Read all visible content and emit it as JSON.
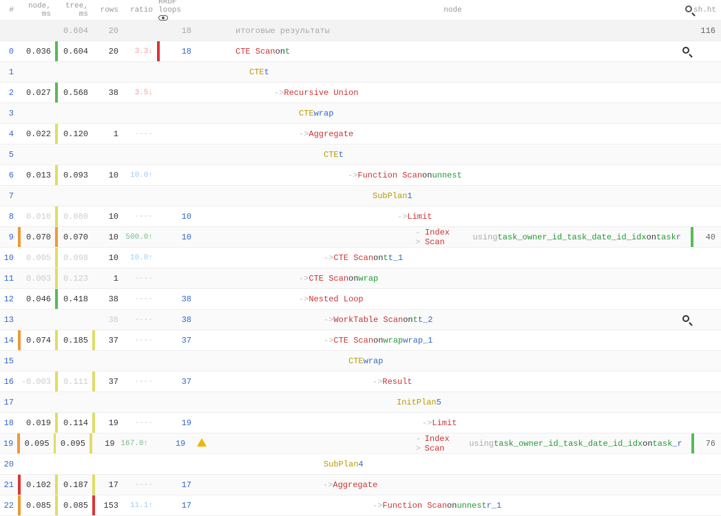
{
  "headers": {
    "idx": "#",
    "node": "node, ms",
    "tree": "tree, ms",
    "rows": "rows",
    "ratio": "ratio",
    "loops": "RRbF loops",
    "main": "node",
    "sh": "sh.ht"
  },
  "summary": {
    "tree": "0.604",
    "rows": "20",
    "loops": "18",
    "label": "итоговые результаты",
    "sh": "116"
  },
  "rows": [
    {
      "i": "0",
      "alt": false,
      "b1": "",
      "node": "0.036",
      "b2": "bar-g",
      "tree": "0.604",
      "b3": "",
      "rows": "20",
      "ratio": "3.3↓",
      "ratioCls": "ratio-down",
      "b4": "bar-r",
      "loops": "18",
      "warn": false,
      "indent": 16,
      "frags": [
        {
          "t": "CTE Scan",
          "c": "op"
        },
        {
          "t": " on ",
          "c": ""
        },
        {
          "t": "t",
          "c": "alias"
        }
      ],
      "mag": true,
      "sh": ""
    },
    {
      "i": "1",
      "alt": true,
      "b1": "",
      "node": "",
      "b2": "",
      "tree": "",
      "b3": "",
      "rows": "",
      "ratio": "",
      "ratioCls": "",
      "b4": "",
      "loops": "",
      "warn": false,
      "indent": 36,
      "frags": [
        {
          "t": "CTE ",
          "c": "kw"
        },
        {
          "t": "t",
          "c": "cte"
        }
      ],
      "mag": false,
      "sh": ""
    },
    {
      "i": "2",
      "alt": false,
      "b1": "",
      "node": "0.027",
      "b2": "bar-g",
      "tree": "0.568",
      "b3": "",
      "rows": "38",
      "ratio": "3.5↓",
      "ratioCls": "ratio-down",
      "b4": "",
      "loops": "",
      "warn": false,
      "indent": 72,
      "frags": [
        {
          "t": "->  ",
          "c": "dim"
        },
        {
          "t": "Recursive Union",
          "c": "op"
        }
      ],
      "mag": false,
      "sh": ""
    },
    {
      "i": "3",
      "alt": true,
      "b1": "",
      "node": "",
      "b2": "",
      "tree": "",
      "b3": "",
      "rows": "",
      "ratio": "",
      "ratioCls": "",
      "b4": "",
      "loops": "",
      "warn": false,
      "indent": 108,
      "frags": [
        {
          "t": "CTE ",
          "c": "kw"
        },
        {
          "t": "wrap",
          "c": "cte"
        }
      ],
      "mag": false,
      "sh": ""
    },
    {
      "i": "4",
      "alt": false,
      "b1": "",
      "node": "0.022",
      "b2": "bar-y",
      "tree": "0.120",
      "b3": "",
      "rows": "1",
      "ratio": "----",
      "ratioCls": "faded",
      "b4": "",
      "loops": "",
      "warn": false,
      "indent": 108,
      "frags": [
        {
          "t": "->  ",
          "c": "dim"
        },
        {
          "t": "Aggregate",
          "c": "op"
        }
      ],
      "mag": false,
      "sh": ""
    },
    {
      "i": "5",
      "alt": true,
      "b1": "",
      "node": "",
      "b2": "",
      "tree": "",
      "b3": "",
      "rows": "",
      "ratio": "",
      "ratioCls": "",
      "b4": "",
      "loops": "",
      "warn": false,
      "indent": 144,
      "frags": [
        {
          "t": "CTE ",
          "c": "kw"
        },
        {
          "t": "t",
          "c": "cte"
        }
      ],
      "mag": false,
      "sh": ""
    },
    {
      "i": "6",
      "alt": false,
      "b1": "",
      "node": "0.013",
      "b2": "bar-y",
      "tree": "0.093",
      "b3": "",
      "rows": "10",
      "ratio": "10.0↑",
      "ratioCls": "ratio-up",
      "b4": "",
      "loops": "",
      "warn": false,
      "indent": 179,
      "frags": [
        {
          "t": "->  ",
          "c": "dim"
        },
        {
          "t": "Function Scan",
          "c": "op"
        },
        {
          "t": " on ",
          "c": ""
        },
        {
          "t": "unnest",
          "c": "alias"
        }
      ],
      "mag": false,
      "sh": ""
    },
    {
      "i": "7",
      "alt": true,
      "b1": "",
      "node": "",
      "b2": "",
      "tree": "",
      "b3": "",
      "rows": "",
      "ratio": "",
      "ratioCls": "",
      "b4": "",
      "loops": "",
      "warn": false,
      "indent": 215,
      "frags": [
        {
          "t": "SubPlan ",
          "c": "kw"
        },
        {
          "t": "1",
          "c": "num"
        }
      ],
      "mag": false,
      "sh": ""
    },
    {
      "i": "8",
      "alt": false,
      "b1": "",
      "nodeCls": "faded",
      "node": "0.010",
      "b2": "bar-y",
      "treeCls": "faded",
      "tree": "0.080",
      "b3": "",
      "rows": "10",
      "ratio": "----",
      "ratioCls": "faded",
      "b4": "",
      "loops": "10",
      "warn": false,
      "indent": 251,
      "frags": [
        {
          "t": "->  ",
          "c": "dim"
        },
        {
          "t": "Limit",
          "c": "op"
        }
      ],
      "mag": false,
      "sh": ""
    },
    {
      "i": "9",
      "alt": true,
      "b1": "bar-o",
      "node": "0.070",
      "b2": "bar-o",
      "tree": "0.070",
      "b3": "",
      "rows": "10",
      "ratio": "500.0↑",
      "ratioCls": "ratio-up2",
      "b4": "",
      "loops": "10",
      "warn": false,
      "indent": 287,
      "frags": [
        {
          "t": "->  ",
          "c": "dim"
        },
        {
          "t": "Index Scan",
          "c": "op"
        },
        {
          "t": " using ",
          "c": "dimtxt"
        },
        {
          "t": "task_owner_id_task_date_id_idx",
          "c": "alias"
        },
        {
          "t": " on ",
          "c": ""
        },
        {
          "t": "task",
          "c": "alias"
        },
        {
          "t": " r",
          "c": "cte"
        }
      ],
      "mag": false,
      "shBar": "bar-g",
      "sh": "40"
    },
    {
      "i": "10",
      "alt": false,
      "b1": "",
      "nodeCls": "faded",
      "node": "0.005",
      "b2": "bar-y",
      "treeCls": "faded",
      "tree": "0.098",
      "b3": "",
      "rows": "10",
      "ratio": "10.0↑",
      "ratioCls": "ratio-up",
      "b4": "",
      "loops": "",
      "warn": false,
      "indent": 144,
      "frags": [
        {
          "t": "->  ",
          "c": "dim"
        },
        {
          "t": "CTE Scan",
          "c": "op"
        },
        {
          "t": " on ",
          "c": ""
        },
        {
          "t": "t",
          "c": "alias"
        },
        {
          "t": " t_1",
          "c": "cte"
        }
      ],
      "mag": false,
      "sh": ""
    },
    {
      "i": "11",
      "alt": true,
      "b1": "",
      "nodeCls": "faded",
      "node": "0.003",
      "b2": "bar-y",
      "treeCls": "faded",
      "tree": "0.123",
      "b3": "",
      "rows": "1",
      "ratio": "----",
      "ratioCls": "faded",
      "b4": "",
      "loops": "",
      "warn": false,
      "indent": 108,
      "frags": [
        {
          "t": "->  ",
          "c": "dim"
        },
        {
          "t": "CTE Scan",
          "c": "op"
        },
        {
          "t": " on ",
          "c": ""
        },
        {
          "t": "wrap",
          "c": "alias"
        }
      ],
      "mag": false,
      "sh": ""
    },
    {
      "i": "12",
      "alt": false,
      "b1": "",
      "node": "0.046",
      "b2": "bar-g",
      "tree": "0.418",
      "b3": "",
      "rows": "38",
      "ratio": "----",
      "ratioCls": "faded",
      "b4": "",
      "loops": "38",
      "warn": false,
      "indent": 108,
      "frags": [
        {
          "t": "->  ",
          "c": "dim"
        },
        {
          "t": "Nested Loop",
          "c": "op"
        }
      ],
      "mag": false,
      "sh": ""
    },
    {
      "i": "13",
      "alt": true,
      "b1": "",
      "node": "",
      "b2": "",
      "tree": "",
      "b3": "",
      "rowsCls": "faded",
      "rows": "38",
      "ratio": "----",
      "ratioCls": "faded",
      "b4": "",
      "loops": "38",
      "warn": false,
      "indent": 144,
      "frags": [
        {
          "t": "->  ",
          "c": "dim"
        },
        {
          "t": "WorkTable Scan",
          "c": "op"
        },
        {
          "t": " on ",
          "c": ""
        },
        {
          "t": "t",
          "c": "alias"
        },
        {
          "t": " t_2",
          "c": "cte"
        }
      ],
      "mag": true,
      "sh": ""
    },
    {
      "i": "14",
      "alt": false,
      "b1": "bar-o",
      "node": "0.074",
      "b2": "bar-y",
      "tree": "0.185",
      "b3": "bar-y",
      "rows": "37",
      "ratio": "----",
      "ratioCls": "faded",
      "b4": "",
      "loops": "37",
      "warn": false,
      "indent": 144,
      "frags": [
        {
          "t": "->  ",
          "c": "dim"
        },
        {
          "t": "CTE Scan",
          "c": "op"
        },
        {
          "t": " on ",
          "c": ""
        },
        {
          "t": "wrap",
          "c": "alias"
        },
        {
          "t": " wrap_1",
          "c": "cte"
        }
      ],
      "mag": false,
      "sh": ""
    },
    {
      "i": "15",
      "alt": true,
      "b1": "",
      "node": "",
      "b2": "",
      "tree": "",
      "b3": "",
      "rows": "",
      "ratio": "",
      "ratioCls": "",
      "b4": "",
      "loops": "",
      "warn": false,
      "indent": 180,
      "frags": [
        {
          "t": "CTE ",
          "c": "kw"
        },
        {
          "t": "wrap",
          "c": "cte"
        }
      ],
      "mag": false,
      "sh": ""
    },
    {
      "i": "16",
      "alt": false,
      "b1": "",
      "nodeCls": "faded",
      "node": "-0.003",
      "b2": "bar-y",
      "treeCls": "faded",
      "tree": "0.111",
      "b3": "bar-y",
      "rows": "37",
      "ratio": "----",
      "ratioCls": "faded",
      "b4": "",
      "loops": "37",
      "warn": false,
      "indent": 215,
      "frags": [
        {
          "t": "->  ",
          "c": "dim"
        },
        {
          "t": "Result",
          "c": "op"
        }
      ],
      "mag": false,
      "sh": ""
    },
    {
      "i": "17",
      "alt": true,
      "b1": "",
      "node": "",
      "b2": "",
      "tree": "",
      "b3": "",
      "rows": "",
      "ratio": "",
      "ratioCls": "",
      "b4": "",
      "loops": "",
      "warn": false,
      "indent": 250,
      "frags": [
        {
          "t": "InitPlan ",
          "c": "kw"
        },
        {
          "t": "5",
          "c": "num"
        }
      ],
      "mag": false,
      "sh": ""
    },
    {
      "i": "18",
      "alt": false,
      "b1": "",
      "node": "0.019",
      "b2": "bar-y",
      "tree": "0.114",
      "b3": "bar-y",
      "rows": "19",
      "ratio": "----",
      "ratioCls": "faded",
      "b4": "",
      "loops": "19",
      "warn": false,
      "indent": 287,
      "frags": [
        {
          "t": "->  ",
          "c": "dim"
        },
        {
          "t": "Limit",
          "c": "op"
        }
      ],
      "mag": false,
      "sh": ""
    },
    {
      "i": "19",
      "alt": true,
      "b1": "bar-o",
      "node": "0.095",
      "b2": "bar-y",
      "tree": "0.095",
      "b3": "bar-y",
      "rows": "19",
      "ratio": "167.0↑",
      "ratioCls": "ratio-up2",
      "b4": "",
      "loops": "19",
      "warn": true,
      "indent": 322,
      "frags": [
        {
          "t": "->  ",
          "c": "dim"
        },
        {
          "t": "Index Scan",
          "c": "op"
        },
        {
          "t": " using ",
          "c": "dimtxt"
        },
        {
          "t": "task_owner_id_task_date_id_idx",
          "c": "alias"
        },
        {
          "t": " on ",
          "c": ""
        },
        {
          "t": "task",
          "c": "alias"
        },
        {
          "t": " _r",
          "c": "cte"
        }
      ],
      "mag": false,
      "shBar": "bar-g",
      "sh": "76"
    },
    {
      "i": "20",
      "alt": false,
      "b1": "",
      "node": "",
      "b2": "",
      "tree": "",
      "b3": "",
      "rows": "",
      "ratio": "",
      "ratioCls": "",
      "b4": "",
      "loops": "",
      "warn": false,
      "indent": 144,
      "frags": [
        {
          "t": "SubPlan ",
          "c": "kw"
        },
        {
          "t": "4",
          "c": "num"
        }
      ],
      "mag": false,
      "sh": ""
    },
    {
      "i": "21",
      "alt": true,
      "b1": "bar-r",
      "node": "0.102",
      "b2": "bar-y",
      "tree": "0.187",
      "b3": "bar-y",
      "rows": "17",
      "ratio": "----",
      "ratioCls": "faded",
      "b4": "",
      "loops": "17",
      "warn": false,
      "indent": 143,
      "frags": [
        {
          "t": "->  ",
          "c": "dim"
        },
        {
          "t": "Aggregate",
          "c": "op"
        }
      ],
      "mag": false,
      "sh": ""
    },
    {
      "i": "22",
      "alt": false,
      "b1": "bar-o",
      "node": "0.085",
      "b2": "bar-y",
      "tree": "0.085",
      "b3": "bar-r",
      "rows": "153",
      "ratio": "11.1↑",
      "ratioCls": "ratio-up",
      "b4": "",
      "loops": "17",
      "warn": false,
      "indent": 215,
      "frags": [
        {
          "t": "->  ",
          "c": "dim"
        },
        {
          "t": "Function Scan",
          "c": "op"
        },
        {
          "t": " on ",
          "c": ""
        },
        {
          "t": "unnest",
          "c": "alias"
        },
        {
          "t": " r_1",
          "c": "cte"
        }
      ],
      "mag": false,
      "sh": ""
    }
  ]
}
